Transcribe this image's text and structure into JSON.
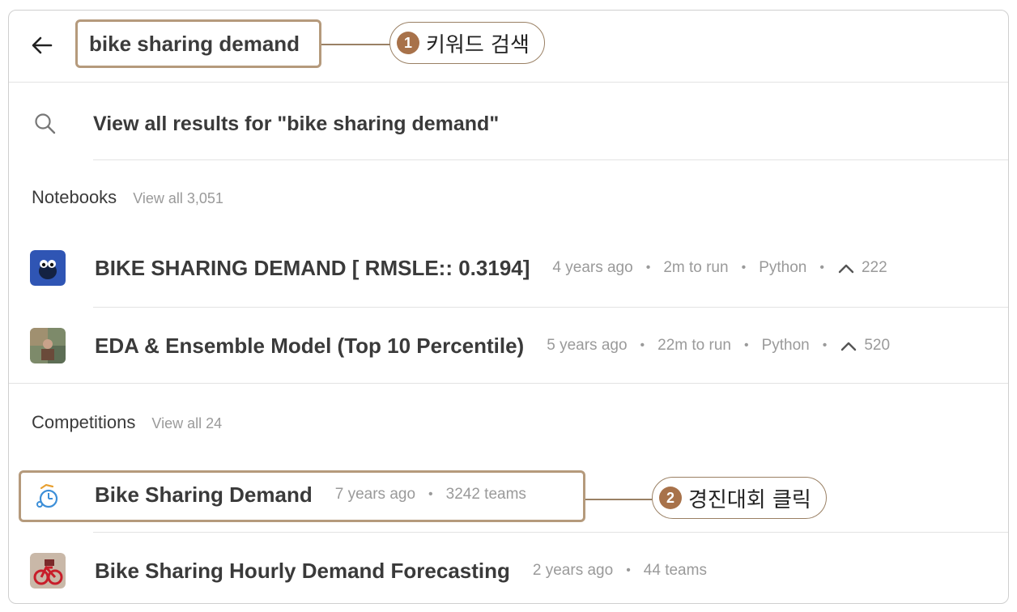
{
  "search": {
    "query": "bike sharing demand"
  },
  "callouts": [
    {
      "number": "1",
      "label": "키워드 검색"
    },
    {
      "number": "2",
      "label": "경진대회 클릭"
    }
  ],
  "view_all": {
    "label": "View all results for \"bike sharing demand\""
  },
  "notebooks": {
    "header": "Notebooks",
    "view_all": "View all 3,051",
    "items": [
      {
        "title": "BIKE SHARING DEMAND [ RMSLE:: 0.3194]",
        "age": "4 years ago",
        "runtime": "2m to run",
        "language": "Python",
        "votes": "222"
      },
      {
        "title": "EDA & Ensemble Model (Top 10 Percentile)",
        "age": "5 years ago",
        "runtime": "22m to run",
        "language": "Python",
        "votes": "520"
      }
    ]
  },
  "competitions": {
    "header": "Competitions",
    "view_all": "View all 24",
    "items": [
      {
        "title": "Bike Sharing Demand",
        "age": "7 years ago",
        "teams": "3242 teams"
      },
      {
        "title": "Bike Sharing Hourly Demand Forecasting",
        "age": "2 years ago",
        "teams": "44 teams"
      }
    ]
  },
  "colors": {
    "accent_border": "#b59a7c",
    "callout_badge": "#a8724a"
  }
}
